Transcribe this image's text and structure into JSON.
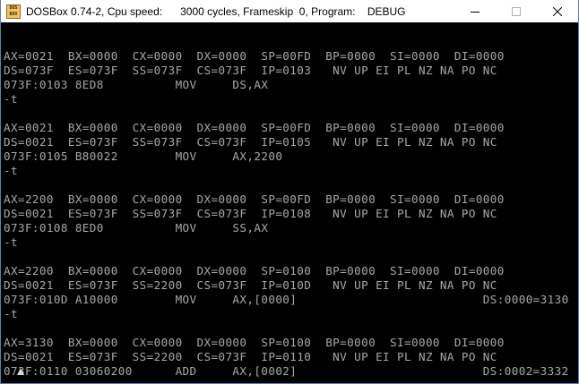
{
  "window": {
    "title": "DOSBox 0.74-2, Cpu speed:      3000 cycles, Frameskip  0, Program:    DEBUG",
    "icon_label_top": "DOS",
    "icon_label_bottom": "BOX"
  },
  "console": {
    "lines": [
      "",
      "AX=0021  BX=0000  CX=0000  DX=0000  SP=00FD  BP=0000  SI=0000  DI=0000",
      "DS=073F  ES=073F  SS=073F  CS=073F  IP=0103   NV UP EI PL NZ NA PO NC",
      "073F:0103 8ED8          MOV     DS,AX",
      "-t",
      "",
      "AX=0021  BX=0000  CX=0000  DX=0000  SP=00FD  BP=0000  SI=0000  DI=0000",
      "DS=0021  ES=073F  SS=073F  CS=073F  IP=0105   NV UP EI PL NZ NA PO NC",
      "073F:0105 B80022        MOV     AX,2200",
      "-t",
      "",
      "AX=2200  BX=0000  CX=0000  DX=0000  SP=00FD  BP=0000  SI=0000  DI=0000",
      "DS=0021  ES=073F  SS=073F  CS=073F  IP=0108   NV UP EI PL NZ NA PO NC",
      "073F:0108 8ED0          MOV     SS,AX",
      "-t",
      "",
      "AX=2200  BX=0000  CX=0000  DX=0000  SP=0100  BP=0000  SI=0000  DI=0000",
      "DS=0021  ES=073F  SS=2200  CS=073F  IP=010D   NV UP EI PL NZ NA PO NC",
      "073F:010D A10000        MOV     AX,[0000]                          DS:0000=3130",
      "-t",
      "",
      "AX=3130  BX=0000  CX=0000  DX=0000  SP=0100  BP=0000  SI=0000  DI=0000",
      "DS=0021  ES=073F  SS=2200  CS=073F  IP=0110   NV UP EI PL NZ NA PO NC",
      "073F:0110 03060200      ADD     AX,[0002]                          DS:0002=3332"
    ],
    "prompt": "-"
  }
}
